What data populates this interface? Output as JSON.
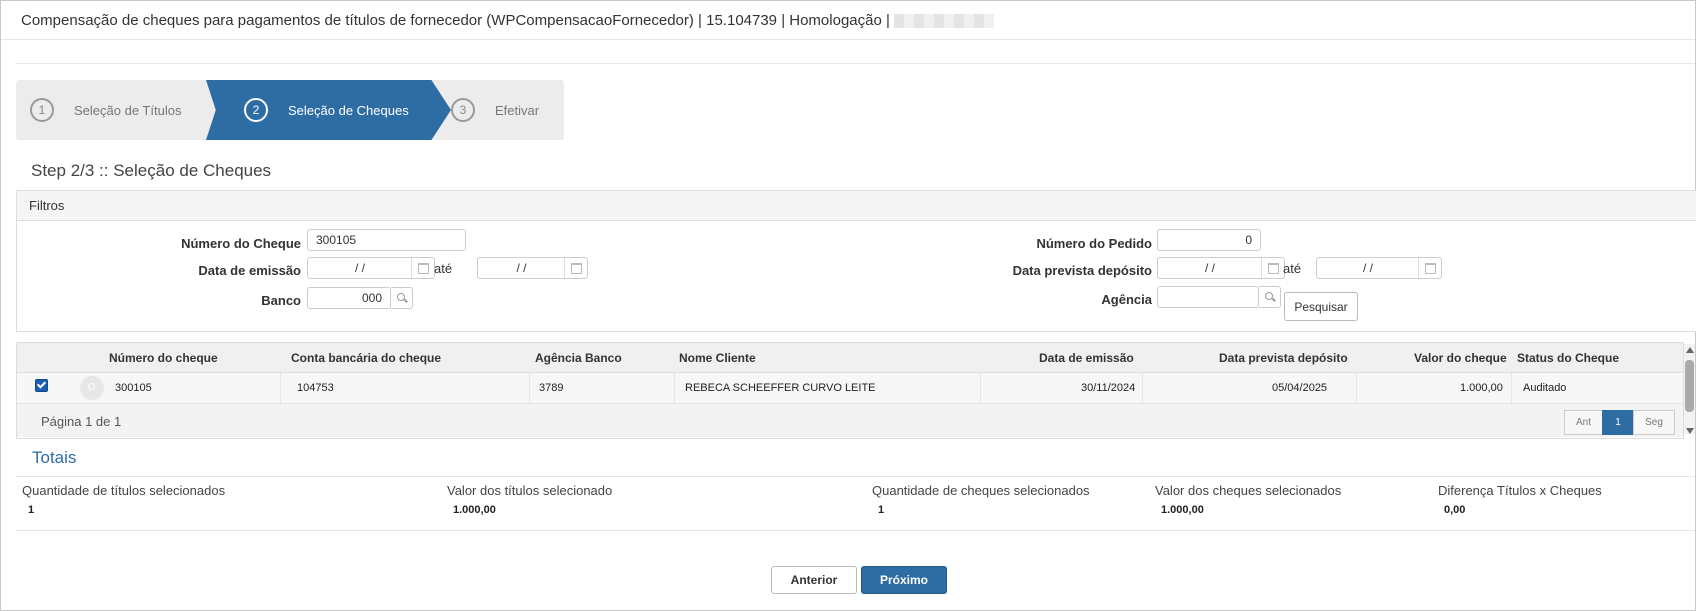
{
  "window": {
    "title": "Compensação de cheques para pagamentos de títulos de fornecedor (WPCompensacaoFornecedor) | 15.104739 | Homologação |"
  },
  "wizard": {
    "steps": [
      {
        "num": "1",
        "label": "Seleção de Títulos"
      },
      {
        "num": "2",
        "label": "Seleção de Cheques"
      },
      {
        "num": "3",
        "label": "Efetivar"
      }
    ],
    "heading": "Step 2/3 :: Seleção de Cheques"
  },
  "filters": {
    "title": "Filtros",
    "numero_cheque": {
      "label": "Número do Cheque",
      "value": "300105"
    },
    "data_emissao": {
      "label": "Data de emissão",
      "from": " /  / ",
      "ate": "até",
      "to": " /  / "
    },
    "banco": {
      "label": "Banco",
      "value": "000"
    },
    "numero_pedido": {
      "label": "Número do Pedido",
      "value": "0"
    },
    "data_prevista": {
      "label": "Data prevista depósito",
      "from": " /  / ",
      "ate": "até",
      "to": " /  / "
    },
    "agencia": {
      "label": "Agência",
      "value": ""
    },
    "pesquisar_label": "Pesquisar"
  },
  "grid": {
    "columns": [
      "Número do cheque",
      "Conta bancária do cheque",
      "Agência Banco",
      "Nome Cliente",
      "Data de emissão",
      "Data prevista depósito",
      "Valor do cheque",
      "Status do Cheque"
    ],
    "rows": [
      {
        "checked": true,
        "numero": "300105",
        "conta": "104753",
        "agencia": "3789",
        "cliente": "REBECA SCHEEFFER CURVO LEITE",
        "emissao": "30/11/2024",
        "prevista": "05/04/2025",
        "valor": "1.000,00",
        "status": "Auditado"
      }
    ],
    "page_info": "Página 1 de 1",
    "pager": {
      "prev": "Ant",
      "current": "1",
      "next": "Seg"
    }
  },
  "totais": {
    "title": "Totais",
    "qtd_titulos": {
      "label": "Quantidade de títulos selecionados",
      "value": "1"
    },
    "valor_titulos": {
      "label": "Valor dos títulos selecionado",
      "value": "1.000,00"
    },
    "qtd_cheques": {
      "label": "Quantidade de cheques selecionados",
      "value": "1"
    },
    "valor_cheques": {
      "label": "Valor dos cheques selecionados",
      "value": "1.000,00"
    },
    "diferenca": {
      "label": "Diferença Títulos x Cheques",
      "value": "0,00"
    }
  },
  "actions": {
    "anterior": "Anterior",
    "proximo": "Próximo"
  },
  "colors": {
    "accent": "#2e6da4"
  }
}
